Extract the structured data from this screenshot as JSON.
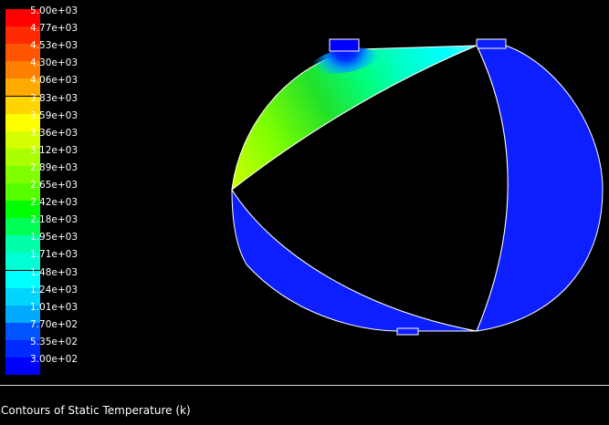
{
  "caption": "Contours of Static Temperature (k)",
  "legend": {
    "ticks": [
      "5.00e+03",
      "4.77e+03",
      "4.53e+03",
      "4.30e+03",
      "4.06e+03",
      "3.83e+03",
      "3.59e+03",
      "3.36e+03",
      "3.12e+03",
      "2.89e+03",
      "2.65e+03",
      "2.42e+03",
      "2.18e+03",
      "1.95e+03",
      "1.71e+03",
      "1.48e+03",
      "1.24e+03",
      "1.01e+03",
      "7.70e+02",
      "5.35e+02",
      "3.00e+02"
    ],
    "colors": [
      "#ff0000",
      "#ff2a00",
      "#ff5500",
      "#ff7f00",
      "#ffaa00",
      "#ffd400",
      "#ffff00",
      "#d4ff00",
      "#aaff00",
      "#7fff00",
      "#55ff00",
      "#00ff00",
      "#00ff55",
      "#00ffaa",
      "#00ffd4",
      "#00ffff",
      "#00d4ff",
      "#00aaff",
      "#0055ff",
      "#002aff",
      "#0000ff"
    ]
  },
  "colors": {
    "chamber_low": "#0d1fff",
    "outline": "#ffffff",
    "background": "#000000"
  }
}
